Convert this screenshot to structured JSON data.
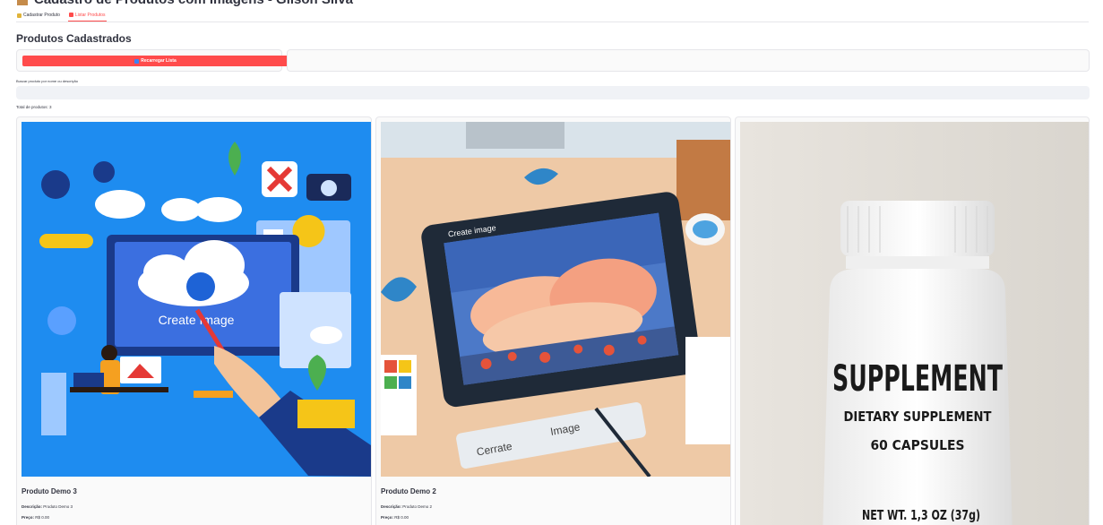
{
  "header": {
    "title": "Cadastro de Produtos com Imagens - Gilson Silva"
  },
  "tabs": [
    {
      "label": "Cadastrar Produto",
      "active": false
    },
    {
      "label": "Listar Produtos",
      "active": true
    }
  ],
  "section_title": "Produtos Cadastrados",
  "reload_button": {
    "label": "Recarregar Lista"
  },
  "search": {
    "label": "Buscar produto por nome ou descrição",
    "value": "",
    "placeholder": ""
  },
  "total_label": "Total de produtos: 3",
  "cards": [
    {
      "name": "Produto Demo 3",
      "desc_label": "Descrição:",
      "desc_value": "Produto Demo 3",
      "price_label": "Preço:",
      "price_value": "R$ 0.00",
      "image": {
        "subject": "illustration of person drawing with cloud upload icon",
        "text": "Create Image"
      }
    },
    {
      "name": "Produto Demo 2",
      "desc_label": "Descrição:",
      "desc_value": "Produto Demo 2",
      "price_label": "Preço:",
      "price_value": "R$ 0.00",
      "image": {
        "subject": "tablet with clouds and butterflies",
        "header_text": "Create image",
        "card_text_left": "Cerrate",
        "card_text_right": "Image"
      }
    },
    {
      "name": "",
      "image": {
        "subject": "white supplement bottle",
        "line1": "SUPPLEMENT",
        "line2": "DIETARY SUPPLEMENT",
        "line3": "60 CAPSULES",
        "line4": "NET WT. 1,3 OZ (37g)"
      }
    }
  ],
  "colors": {
    "accent": "#ff4b4b",
    "text": "#31333f",
    "input_bg": "#f0f2f6",
    "panel_bg": "#fafafa",
    "border": "#e6e6ea"
  }
}
